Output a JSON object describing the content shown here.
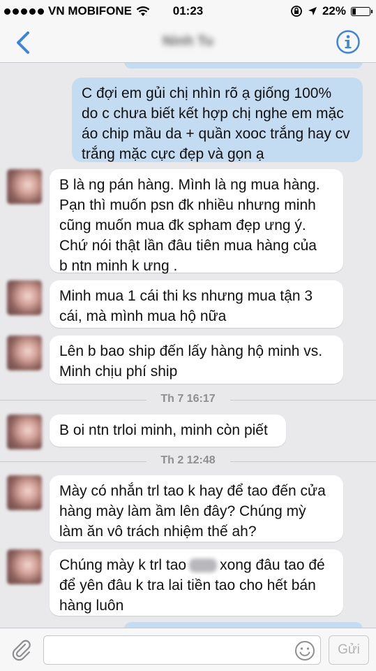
{
  "status_bar": {
    "carrier": "VN MOBIFONE",
    "time": "01:23",
    "battery": "22%",
    "battery_level": 0.22,
    "signal_dots": 5
  },
  "nav": {
    "title": "Ninh Tu",
    "back_icon": "chevron-left-icon",
    "info_icon": "info-icon",
    "accent_color": "#3b86d8"
  },
  "messages": [
    {
      "type": "out",
      "lines": [
        "C đợi em gủi chị nhìn rõ ạ giống 100%",
        "do c chưa biết kết hợp chị nghe em mặc",
        "áo chip mầu da + quần xooc trắng hay cv",
        "trắng mặc cực đẹp và gọn ạ"
      ]
    },
    {
      "type": "in",
      "lines": [
        "B là ng pán hàng. Mình là ng mua hàng.",
        "Pạn thì muốn psn đk nhiều nhưng minh",
        "cũng muốn mua đk spham đẹp ưng ý.",
        "Chứ nói thật lần đâu tiên mua hàng của",
        "b ntn minh k ưng ."
      ]
    },
    {
      "type": "in",
      "lines": [
        "Minh mua 1 cái thi ks nhưng mua tận 3",
        "cái, mà mình mua hộ nữa"
      ]
    },
    {
      "type": "in",
      "lines": [
        "Lên b bao ship đến lấy hàng hộ minh vs.",
        "Minh chịu phí ship"
      ]
    },
    {
      "type": "timestamp",
      "text": "Th 7 16:17"
    },
    {
      "type": "in",
      "lines": [
        "B oi ntn trloi minh,  minh còn piết"
      ]
    },
    {
      "type": "timestamp",
      "text": "Th 2 12:48"
    },
    {
      "type": "in",
      "lines": [
        "Mày có nhắn trl tao k hay để tao đến cửa",
        "hàng mày làm ầm lên đây? Chúng mỳ",
        "làm ăn vô trách nhiệm thế ah?"
      ]
    },
    {
      "type": "in",
      "lines": [
        "Chúng mày k trl tao",
        "xong đâu tao đé",
        "để yên đâu k tra lai tiền tao cho hết bán",
        "hàng luôn"
      ]
    }
  ],
  "input": {
    "placeholder": "",
    "send_label": "Gửi"
  },
  "colors": {
    "outgoing_bubble": "#c3dcf2",
    "incoming_bubble": "#ffffff",
    "background": "#e9e9eb",
    "timestamp": "#8e8e93"
  }
}
